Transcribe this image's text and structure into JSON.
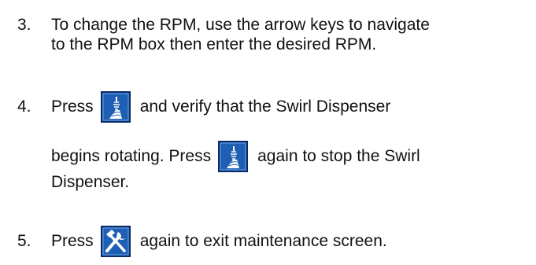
{
  "steps": [
    {
      "number": "3.",
      "lines": [
        "To change the RPM, use the arrow keys to navigate",
        "to the RPM box then enter the desired RPM."
      ]
    },
    {
      "number": "4.",
      "line1_before": "Press",
      "line1_after": "and verify that the Swirl Dispenser",
      "line2_before": "begins rotating. Press",
      "line2_after": "again to stop the Swirl",
      "line3": "Dispenser.",
      "icon": "swirl-dispenser-icon"
    },
    {
      "number": "5.",
      "line1_before": "Press",
      "line1_after": "again to exit maintenance screen.",
      "icon": "maintenance-tools-icon"
    }
  ],
  "colors": {
    "icon_blue": "#1e5fb4",
    "icon_border": "#0a2a66",
    "text": "#111111"
  }
}
